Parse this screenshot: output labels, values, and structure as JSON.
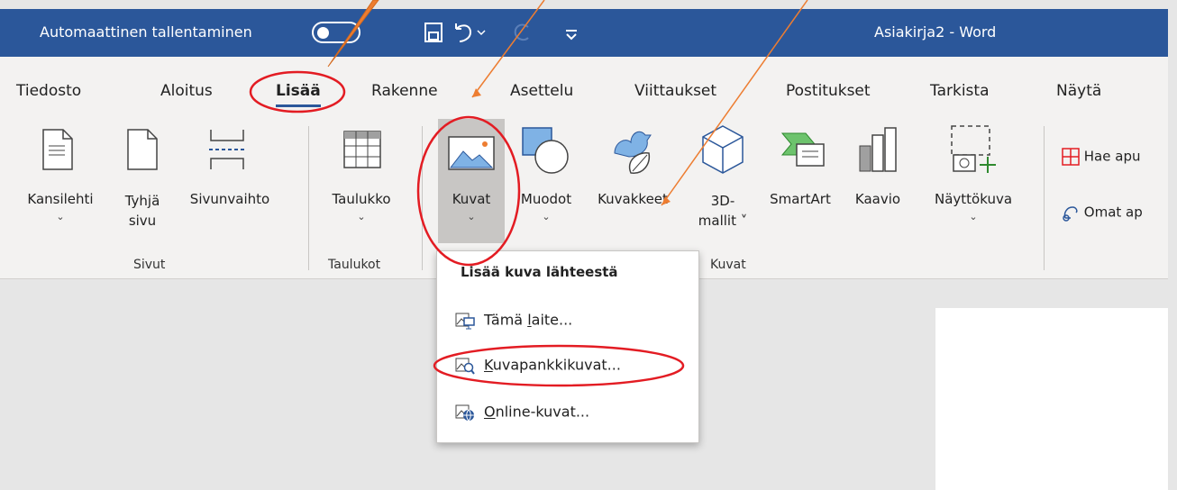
{
  "titlebar": {
    "autosave_label": "Automaattinen tallentaminen",
    "doc_title": "Asiakirja2  -  Word"
  },
  "tabs": [
    "Tiedosto",
    "Aloitus",
    "Lisää",
    "Rakenne",
    "Asettelu",
    "Viittaukset",
    "Postitukset",
    "Tarkista",
    "Näytä"
  ],
  "buttons": {
    "kansilehti": "Kansilehti",
    "tyhja_1": "Tyhjä",
    "tyhja_2": "sivu",
    "sivunvaihto": "Sivunvaihto",
    "taulukko": "Taulukko",
    "kuvat": "Kuvat",
    "muodot": "Muodot",
    "kuvakkeet": "Kuvakkeet",
    "mallit_1": "3D-",
    "mallit_2": "mallit ˅",
    "smartart": "SmartArt",
    "kaavio": "Kaavio",
    "nayttokuva": "Näyttökuva"
  },
  "groups": {
    "sivut": "Sivut",
    "taulukot": "Taulukot",
    "kuvat": "Kuvat"
  },
  "right": {
    "hae": "Hae apu",
    "omat": "Omat ap"
  },
  "menu": {
    "header": "Lisää kuva lähteestä",
    "items": [
      {
        "pre": "Tämä ",
        "u": "l",
        "post": "aite..."
      },
      {
        "pre": "",
        "u": "K",
        "post": "uvapankkikuvat..."
      },
      {
        "pre": "",
        "u": "O",
        "post": "nline-kuvat..."
      }
    ]
  },
  "colors": {
    "accent": "#2b579a",
    "annotation": "#e31c23",
    "arrow": "#ed7d31"
  }
}
